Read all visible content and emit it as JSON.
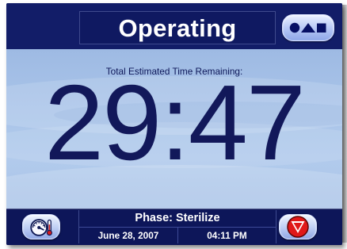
{
  "header": {
    "title": "Operating"
  },
  "shape_button": {
    "icon": "circle-triangle-square-icon"
  },
  "main": {
    "label": "Total Estimated Time Remaining:",
    "time": "29:47"
  },
  "footer": {
    "phase": "Phase: Sterilize",
    "date": "June 28, 2007",
    "time": "04:11 PM",
    "left_button_icon": "thermometer-gauge-icon",
    "right_button_icon": "down-triangle-icon"
  },
  "colors": {
    "panel_navy": "#0c1656",
    "screen_blue": "#a7c2e8",
    "stop_red": "#e01818"
  }
}
